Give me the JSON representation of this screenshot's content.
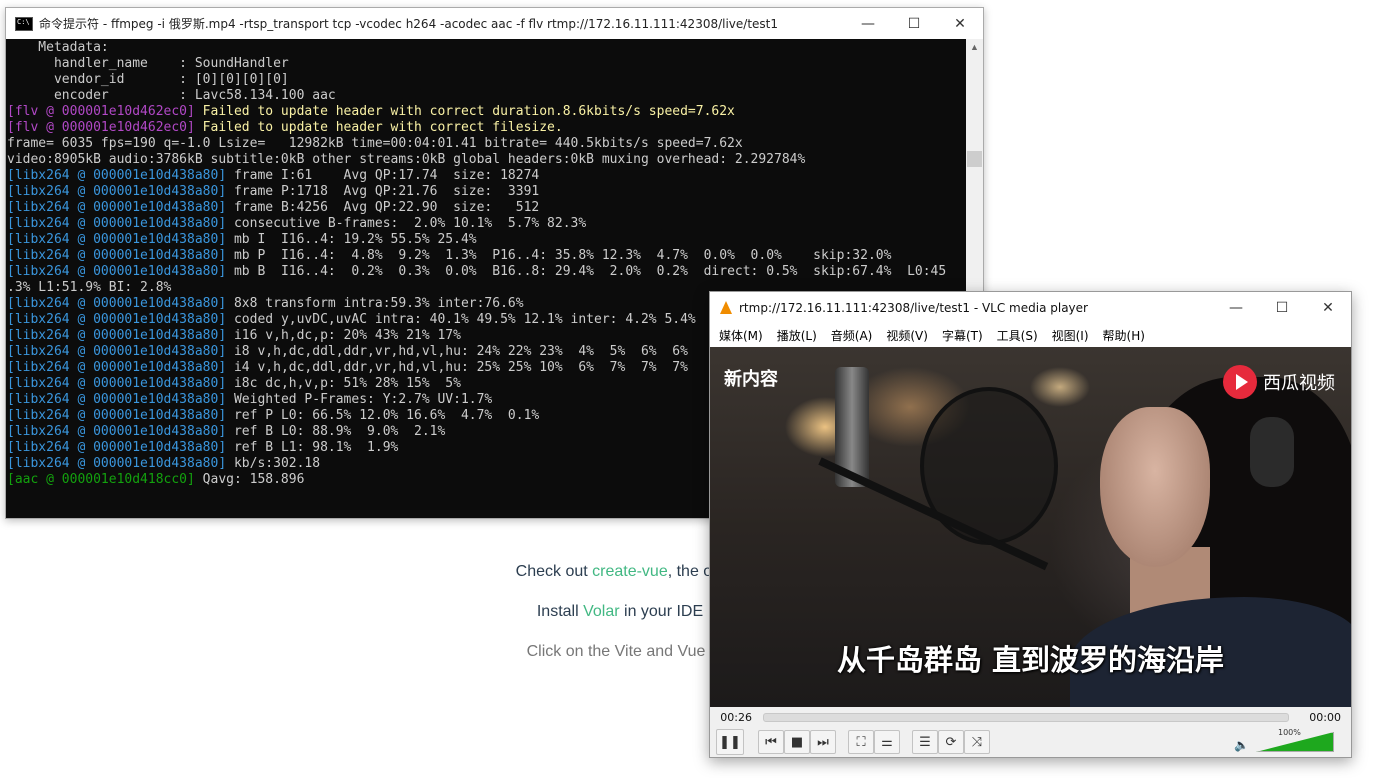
{
  "background_page": {
    "line1_pre": "Check out ",
    "line1_link": "create-vue",
    "line1_post": ", the offi",
    "line2_pre": "Install ",
    "line2_link": "Volar",
    "line2_post": " in your IDE",
    "line3": "Click on the Vite and Vue l"
  },
  "cmd": {
    "title": "命令提示符 - ffmpeg  -i 俄罗斯.mp4 -rtsp_transport tcp -vcodec h264 -acodec aac -f flv rtmp://172.16.11.111:42308/live/test1",
    "minimize": "—",
    "maximize": "☐",
    "close": "✕",
    "lines": [
      {
        "tag": "",
        "cls": "msg",
        "text": "    Metadata:"
      },
      {
        "tag": "",
        "cls": "msg",
        "text": "      handler_name    : SoundHandler"
      },
      {
        "tag": "",
        "cls": "msg",
        "text": "      vendor_id       : [0][0][0][0]"
      },
      {
        "tag": "",
        "cls": "msg",
        "text": "      encoder         : Lavc58.134.100 aac"
      },
      {
        "tag": "[flv @ 000001e10d462ec0]",
        "tagcls": "tag-flv",
        "cls": "msg-y",
        "text": " Failed to update header with correct duration.8.6kbits/s speed=7.62x"
      },
      {
        "tag": "[flv @ 000001e10d462ec0]",
        "tagcls": "tag-flv",
        "cls": "msg-y",
        "text": " Failed to update header with correct filesize."
      },
      {
        "tag": "",
        "cls": "msg",
        "text": "frame= 6035 fps=190 q=-1.0 Lsize=   12982kB time=00:04:01.41 bitrate= 440.5kbits/s speed=7.62x"
      },
      {
        "tag": "",
        "cls": "msg",
        "text": "video:8905kB audio:3786kB subtitle:0kB other streams:0kB global headers:0kB muxing overhead: 2.292784%"
      },
      {
        "tag": "[libx264 @ 000001e10d438a80]",
        "tagcls": "tag-x264",
        "cls": "msg",
        "text": " frame I:61    Avg QP:17.74  size: 18274"
      },
      {
        "tag": "[libx264 @ 000001e10d438a80]",
        "tagcls": "tag-x264",
        "cls": "msg",
        "text": " frame P:1718  Avg QP:21.76  size:  3391"
      },
      {
        "tag": "[libx264 @ 000001e10d438a80]",
        "tagcls": "tag-x264",
        "cls": "msg",
        "text": " frame B:4256  Avg QP:22.90  size:   512"
      },
      {
        "tag": "[libx264 @ 000001e10d438a80]",
        "tagcls": "tag-x264",
        "cls": "msg",
        "text": " consecutive B-frames:  2.0% 10.1%  5.7% 82.3%"
      },
      {
        "tag": "[libx264 @ 000001e10d438a80]",
        "tagcls": "tag-x264",
        "cls": "msg",
        "text": " mb I  I16..4: 19.2% 55.5% 25.4%"
      },
      {
        "tag": "[libx264 @ 000001e10d438a80]",
        "tagcls": "tag-x264",
        "cls": "msg",
        "text": " mb P  I16..4:  4.8%  9.2%  1.3%  P16..4: 35.8% 12.3%  4.7%  0.0%  0.0%    skip:32.0%"
      },
      {
        "tag": "[libx264 @ 000001e10d438a80]",
        "tagcls": "tag-x264",
        "cls": "msg",
        "text": " mb B  I16..4:  0.2%  0.3%  0.0%  B16..8: 29.4%  2.0%  0.2%  direct: 0.5%  skip:67.4%  L0:45"
      },
      {
        "tag": "",
        "cls": "msg",
        "text": ".3% L1:51.9% BI: 2.8%"
      },
      {
        "tag": "[libx264 @ 000001e10d438a80]",
        "tagcls": "tag-x264",
        "cls": "msg",
        "text": " 8x8 transform intra:59.3% inter:76.6%"
      },
      {
        "tag": "[libx264 @ 000001e10d438a80]",
        "tagcls": "tag-x264",
        "cls": "msg",
        "text": " coded y,uvDC,uvAC intra: 40.1% 49.5% 12.1% inter: 4.2% 5.4%"
      },
      {
        "tag": "[libx264 @ 000001e10d438a80]",
        "tagcls": "tag-x264",
        "cls": "msg",
        "text": " i16 v,h,dc,p: 20% 43% 21% 17%"
      },
      {
        "tag": "[libx264 @ 000001e10d438a80]",
        "tagcls": "tag-x264",
        "cls": "msg",
        "text": " i8 v,h,dc,ddl,ddr,vr,hd,vl,hu: 24% 22% 23%  4%  5%  6%  6%"
      },
      {
        "tag": "[libx264 @ 000001e10d438a80]",
        "tagcls": "tag-x264",
        "cls": "msg",
        "text": " i4 v,h,dc,ddl,ddr,vr,hd,vl,hu: 25% 25% 10%  6%  7%  7%  7%"
      },
      {
        "tag": "[libx264 @ 000001e10d438a80]",
        "tagcls": "tag-x264",
        "cls": "msg",
        "text": " i8c dc,h,v,p: 51% 28% 15%  5%"
      },
      {
        "tag": "[libx264 @ 000001e10d438a80]",
        "tagcls": "tag-x264",
        "cls": "msg",
        "text": " Weighted P-Frames: Y:2.7% UV:1.7%"
      },
      {
        "tag": "[libx264 @ 000001e10d438a80]",
        "tagcls": "tag-x264",
        "cls": "msg",
        "text": " ref P L0: 66.5% 12.0% 16.6%  4.7%  0.1%"
      },
      {
        "tag": "[libx264 @ 000001e10d438a80]",
        "tagcls": "tag-x264",
        "cls": "msg",
        "text": " ref B L0: 88.9%  9.0%  2.1%"
      },
      {
        "tag": "[libx264 @ 000001e10d438a80]",
        "tagcls": "tag-x264",
        "cls": "msg",
        "text": " ref B L1: 98.1%  1.9%"
      },
      {
        "tag": "[libx264 @ 000001e10d438a80]",
        "tagcls": "tag-x264",
        "cls": "msg",
        "text": " kb/s:302.18"
      },
      {
        "tag": "[aac @ 000001e10d418cc0]",
        "tagcls": "tag-aac",
        "cls": "msg",
        "text": " Qavg: 158.896"
      }
    ]
  },
  "vlc": {
    "title": "rtmp://172.16.11.111:42308/live/test1 - VLC media player",
    "minimize": "—",
    "maximize": "☐",
    "close": "✕",
    "menu": [
      "媒体(M)",
      "播放(L)",
      "音频(A)",
      "视频(V)",
      "字幕(T)",
      "工具(S)",
      "视图(I)",
      "帮助(H)"
    ],
    "watermark_left": "新内容",
    "watermark_right": "西瓜视频",
    "subtitle": "从千岛群岛 直到波罗的海沿岸",
    "time_elapsed": "00:26",
    "time_total": "00:00",
    "volume_label": "100%",
    "volume_level": 1.0,
    "controls": {
      "pause": "❚❚",
      "prev": "⏮",
      "stop": "■",
      "next": "⏭",
      "fullscreen": "⛶",
      "extended": "⚌",
      "playlist": "☰",
      "loop": "⟳",
      "shuffle": "⤨",
      "volume_icon": "🔈"
    }
  }
}
